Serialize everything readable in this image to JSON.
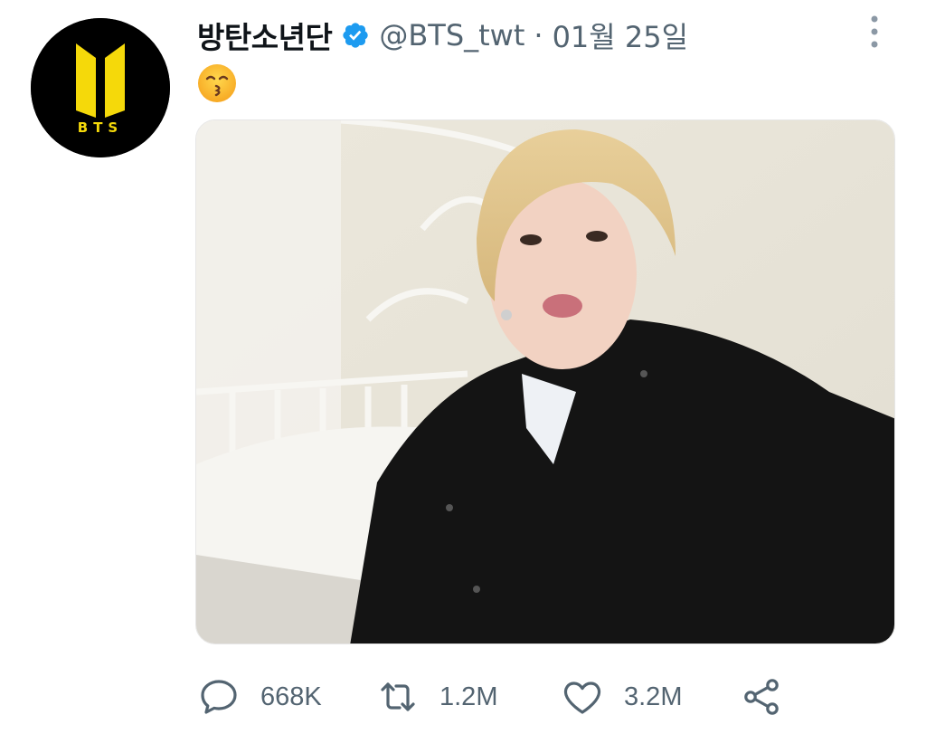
{
  "tweet": {
    "display_name": "방탄소년단",
    "handle": "@BTS_twt",
    "separator": "·",
    "date": "01월 25일",
    "emoji_icon": "kissing-face-icon",
    "avatar_logo_text": "BTS",
    "verified_icon": "verified-badge-icon",
    "more_icon": "more-vertical-icon"
  },
  "actions": {
    "reply": {
      "icon": "reply-icon",
      "count": "668K"
    },
    "retweet": {
      "icon": "retweet-icon",
      "count": "1.2M"
    },
    "like": {
      "icon": "heart-icon",
      "count": "3.2M"
    },
    "share": {
      "icon": "share-icon"
    }
  },
  "colors": {
    "verified": "#1d9bf0",
    "text_primary": "#0f1419",
    "text_secondary": "#536471",
    "avatar_bg": "#000000",
    "logo_yellow": "#f5d90a"
  }
}
